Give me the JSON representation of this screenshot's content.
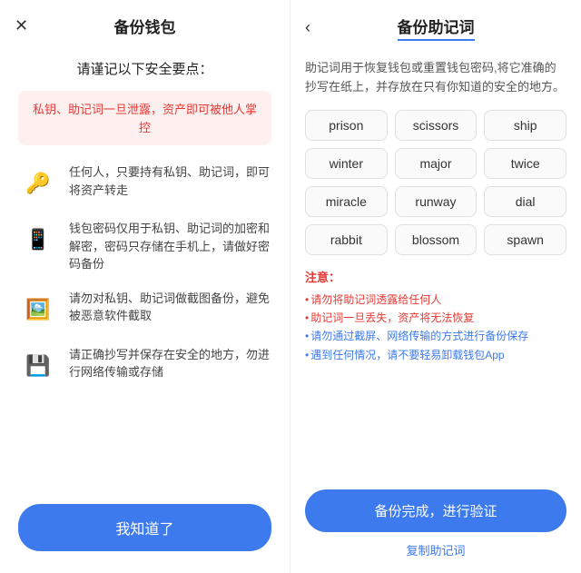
{
  "left": {
    "title": "备份钱包",
    "close_label": "✕",
    "subtitle": "请谨记以下安全要点：",
    "warning": "私钥、助记词一旦泄露，资产即可被他人掌控",
    "items": [
      {
        "icon": "🔑",
        "text": "任何人，只要持有私钥、助记词，即可将资产转走"
      },
      {
        "icon": "📱",
        "text": "钱包密码仅用于私钥、助记词的加密和解密，密码只存储在手机上，请做好密码备份"
      },
      {
        "icon": "🖼",
        "text": "请勿对私钥、助记词做截图备份，避免被恶意软件截取"
      },
      {
        "icon": "💾",
        "text": "请正确抄写并保存在安全的地方，勿进行网络传输或存储"
      }
    ],
    "btn_label": "我知道了"
  },
  "right": {
    "title": "备份助记词",
    "back_label": "‹",
    "description": "助记词用于恢复钱包或重置钱包密码,将它准确的抄写在纸上，并存放在只有你知道的安全的地方。",
    "words": [
      "prison",
      "scissors",
      "ship",
      "winter",
      "major",
      "twice",
      "miracle",
      "runway",
      "dial",
      "rabbit",
      "blossom",
      "spawn"
    ],
    "notice_title": "注意：",
    "notices": [
      {
        "text": "请勿将助记词透露给任何人",
        "color": "red"
      },
      {
        "text": "助记词一旦丢失，资产将无法恢复",
        "color": "red"
      },
      {
        "text": "请勿通过截屏、网络传输的方式进行备份保存",
        "color": "blue"
      },
      {
        "text": "遇到任何情况，请不要轻易卸载钱包App",
        "color": "blue"
      }
    ],
    "btn_label": "备份完成，进行验证",
    "copy_label": "复制助记词"
  }
}
